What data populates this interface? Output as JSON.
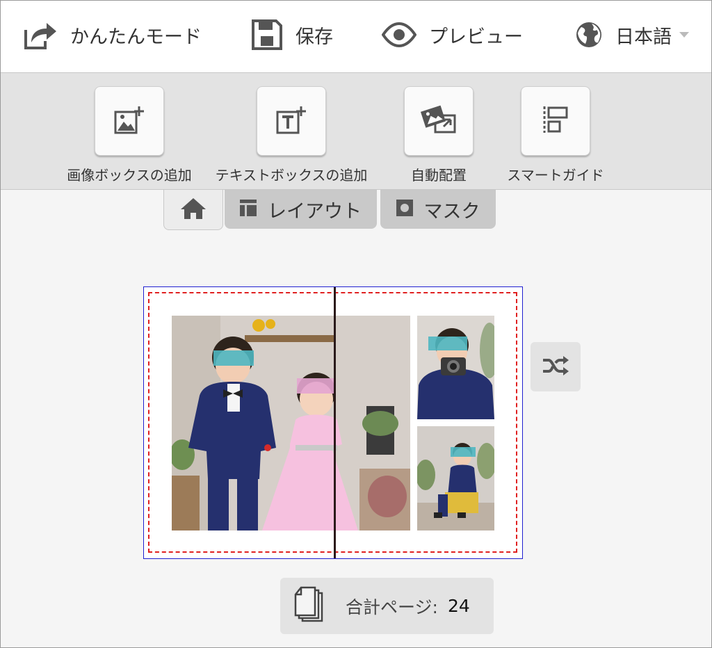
{
  "topbar": {
    "easy_mode": "かんたんモード",
    "save": "保存",
    "preview": "プレビュー",
    "language": "日本語"
  },
  "toolbar": {
    "add_image_box": "画像ボックスの追加",
    "add_text_box": "テキストボックスの追加",
    "auto_layout": "自動配置",
    "smart_guide": "スマートガイド"
  },
  "tabs": {
    "layout": "レイアウト",
    "mask": "マスク"
  },
  "pages": {
    "label": "合計ページ:",
    "count": "24"
  },
  "icons": [
    "share-icon",
    "save-icon",
    "eye-icon",
    "globe-icon",
    "image-add-icon",
    "text-add-icon",
    "auto-layout-icon",
    "smart-guide-icon",
    "home-icon",
    "layout-icon",
    "mask-icon",
    "shuffle-icon",
    "pages-icon"
  ],
  "colors": {
    "spread_border": "#1f1fd0",
    "bleed_line": "#e02020",
    "toolbar_bg": "#e3e3e3",
    "tab_bg": "#c9c9c9"
  }
}
